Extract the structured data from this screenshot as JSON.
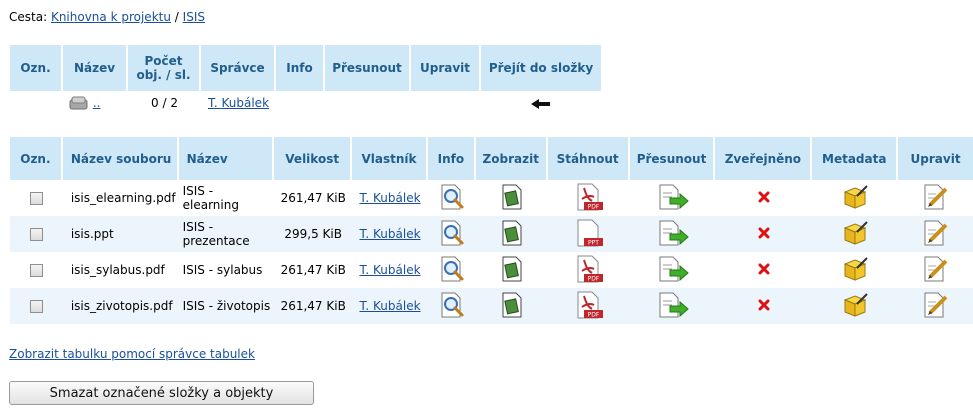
{
  "breadcrumb": {
    "prefix": "Cesta:",
    "items": [
      {
        "label": "Knihovna k projektu"
      },
      {
        "label": "ISIS"
      }
    ],
    "separator": "/"
  },
  "folder_table": {
    "headers": [
      "Ozn.",
      "Název",
      "Počet obj. / sl.",
      "Správce",
      "Info",
      "Přesunout",
      "Upravit",
      "Přejít do složky"
    ],
    "rows": [
      {
        "name": "..",
        "count": "0 / 2",
        "owner": "T. Kubálek",
        "go_icon": "arrow-left-icon"
      }
    ]
  },
  "file_table": {
    "headers": [
      "Ozn.",
      "Název souboru",
      "Název",
      "Velikost",
      "Vlastník",
      "Info",
      "Zobrazit",
      "Stáhnout",
      "Přesunout",
      "Zveřejněno",
      "Metadata",
      "Upravit"
    ],
    "rows": [
      {
        "file": "isis_elearning.pdf",
        "title": "ISIS - elearning",
        "size": "261,47 KiB",
        "owner": "T. Kubálek",
        "type": "PDF",
        "published": false
      },
      {
        "file": "isis.ppt",
        "title": "ISIS - prezentace",
        "size": "299,5 KiB",
        "owner": "T. Kubálek",
        "type": "PPT",
        "published": false
      },
      {
        "file": "isis_sylabus.pdf",
        "title": "ISIS - sylabus",
        "size": "261,47 KiB",
        "owner": "T. Kubálek",
        "type": "PDF",
        "published": false
      },
      {
        "file": "isis_zivotopis.pdf",
        "title": "ISIS - životopis",
        "size": "261,47 KiB",
        "owner": "T. Kubálek",
        "type": "PDF",
        "published": false
      }
    ]
  },
  "links": {
    "table_manager": "Zobrazit tabulku pomocí správce tabulek"
  },
  "actions": {
    "delete_selected": "Smazat označené složky a objekty"
  },
  "colors": {
    "header_bg": "#cfe8f7",
    "header_text": "#215e8e",
    "row_alt": "#ebf5fb",
    "link": "#1a4f9c"
  }
}
